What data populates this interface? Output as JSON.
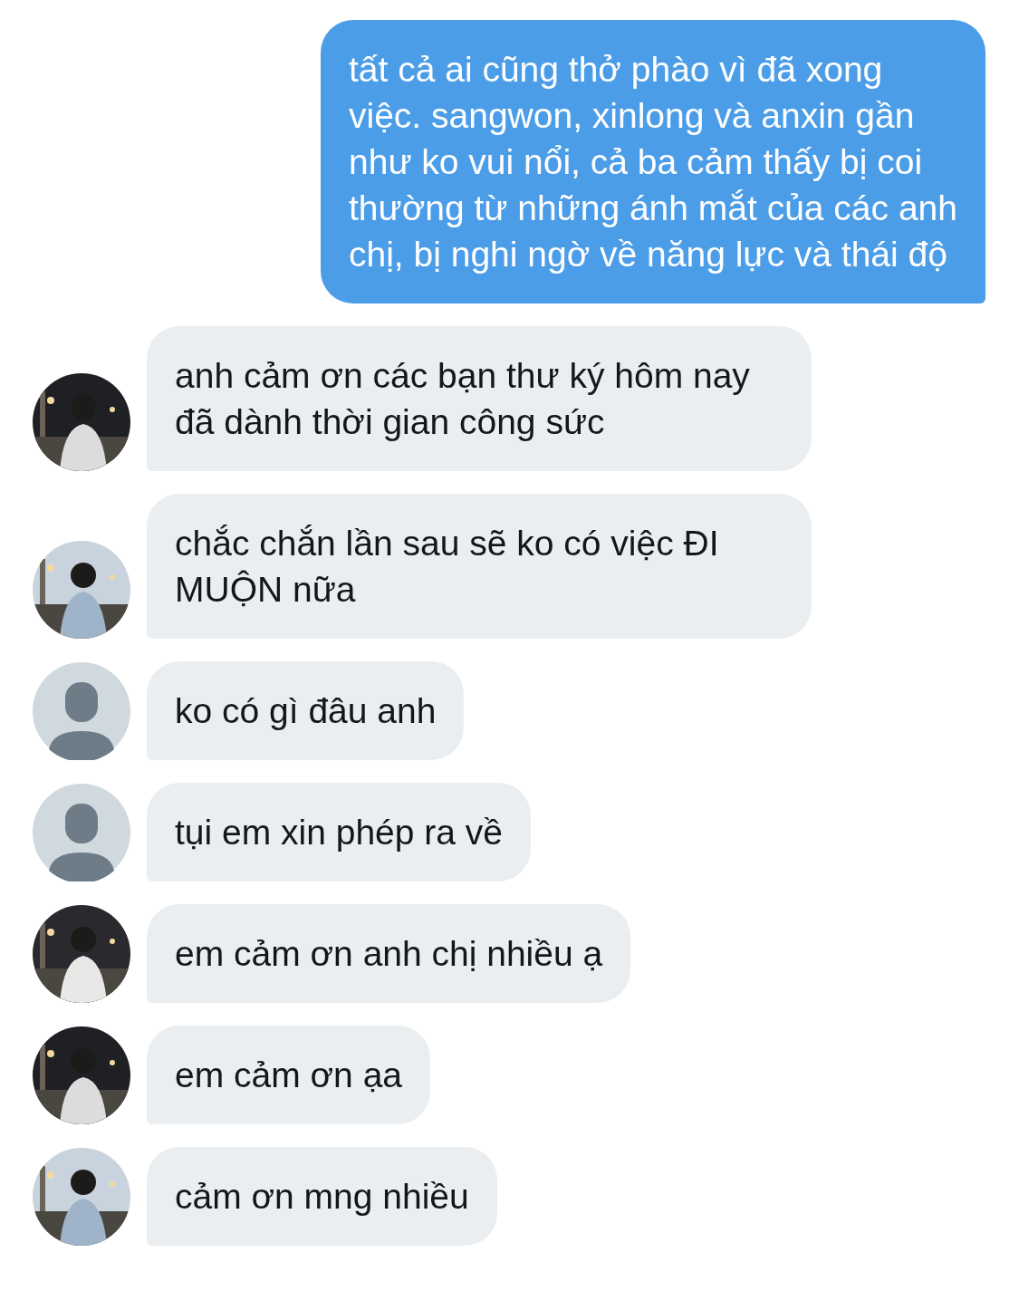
{
  "messages": [
    {
      "kind": "sent",
      "text": "tất cả ai cũng thở phào vì đã xong việc. sangwon, xinlong và anxin gần như ko vui nổi, cả ba cảm thấy bị coi thường từ những ánh mắt của các anh chị, bị nghi ngờ về năng lực và thái độ"
    },
    {
      "kind": "received",
      "text": "anh cảm ơn các bạn thư ký hôm nay đã dành thời gian công sức"
    },
    {
      "kind": "received",
      "text": "chắc chắn lần sau sẽ ko có việc ĐI MUỘN nữa"
    },
    {
      "kind": "received",
      "avatar": {
        "kind": "default"
      },
      "text": "ko có gì đâu anh"
    },
    {
      "kind": "received",
      "avatar": {
        "kind": "default"
      },
      "text": "tụi em xin phép ra về"
    },
    {
      "kind": "received",
      "text": "em cảm ơn anh chị nhiều ạ"
    },
    {
      "kind": "received",
      "text": "em cảm ơn ạa"
    },
    {
      "kind": "received",
      "text": "cảm ơn mng nhiều"
    }
  ]
}
